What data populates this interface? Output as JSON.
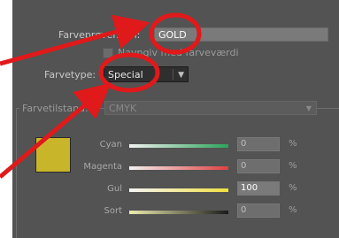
{
  "dialog": {
    "swatch_name_label": "Farveprøvenavn:",
    "swatch_name_value": "GOLD",
    "name_with_value_label": "Navngiv med farveværdi",
    "color_type_label": "Farvetype:",
    "color_type_value": "Special",
    "color_mode_label": "Farvetilstand:",
    "color_mode_value": "CMYK"
  },
  "channels": [
    {
      "label": "Cyan",
      "value": "0",
      "unit": "%"
    },
    {
      "label": "Magenta",
      "value": "0",
      "unit": "%"
    },
    {
      "label": "Gul",
      "value": "100",
      "unit": "%"
    },
    {
      "label": "Sort",
      "value": "0",
      "unit": "%"
    }
  ],
  "colors": {
    "panel_bg": "#535353",
    "swatch": "#c9b52a",
    "annotation_red": "#e0191b"
  }
}
